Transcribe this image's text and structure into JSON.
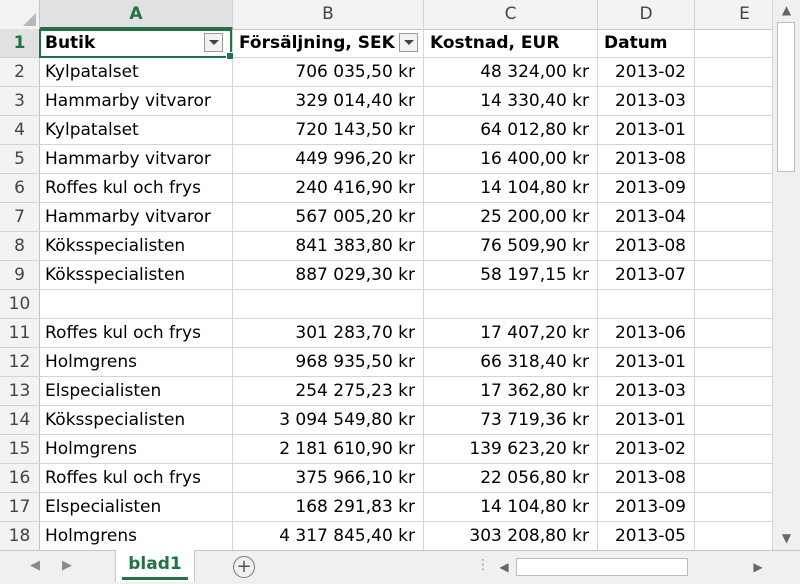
{
  "columns": [
    "A",
    "B",
    "C",
    "D",
    "E"
  ],
  "active_column": "A",
  "header_row": {
    "row_number": "1",
    "butik": "Butik",
    "forsaljning": "Försäljning, SEK",
    "kostnad": "Kostnad, EUR",
    "datum": "Datum"
  },
  "rows": [
    {
      "n": "2",
      "butik": "Kylpatalset",
      "forsaljning": "706 035,50 kr",
      "kostnad": "48 324,00 kr",
      "datum": "2013-02"
    },
    {
      "n": "3",
      "butik": "Hammarby vitvaror",
      "forsaljning": "329 014,40 kr",
      "kostnad": "14 330,40 kr",
      "datum": "2013-03"
    },
    {
      "n": "4",
      "butik": "Kylpatalset",
      "forsaljning": "720 143,50 kr",
      "kostnad": "64 012,80 kr",
      "datum": "2013-01"
    },
    {
      "n": "5",
      "butik": "Hammarby vitvaror",
      "forsaljning": "449 996,20 kr",
      "kostnad": "16 400,00 kr",
      "datum": "2013-08"
    },
    {
      "n": "6",
      "butik": "Roffes kul och frys",
      "forsaljning": "240 416,90 kr",
      "kostnad": "14 104,80 kr",
      "datum": "2013-09"
    },
    {
      "n": "7",
      "butik": "Hammarby vitvaror",
      "forsaljning": "567 005,20 kr",
      "kostnad": "25 200,00 kr",
      "datum": "2013-04"
    },
    {
      "n": "8",
      "butik": "Köksspecialisten",
      "forsaljning": "841 383,80 kr",
      "kostnad": "76 509,90 kr",
      "datum": "2013-08"
    },
    {
      "n": "9",
      "butik": "Köksspecialisten",
      "forsaljning": "887 029,30 kr",
      "kostnad": "58 197,15 kr",
      "datum": "2013-07"
    },
    {
      "n": "10",
      "butik": "",
      "forsaljning": "",
      "kostnad": "",
      "datum": ""
    },
    {
      "n": "11",
      "butik": "Roffes kul och frys",
      "forsaljning": "301 283,70 kr",
      "kostnad": "17 407,20 kr",
      "datum": "2013-06"
    },
    {
      "n": "12",
      "butik": "Holmgrens",
      "forsaljning": "968 935,50 kr",
      "kostnad": "66 318,40 kr",
      "datum": "2013-01"
    },
    {
      "n": "13",
      "butik": "Elspecialisten",
      "forsaljning": "254 275,23 kr",
      "kostnad": "17 362,80 kr",
      "datum": "2013-03"
    },
    {
      "n": "14",
      "butik": "Köksspecialisten",
      "forsaljning": "3 094 549,80 kr",
      "kostnad": "73 719,36 kr",
      "datum": "2013-01"
    },
    {
      "n": "15",
      "butik": "Holmgrens",
      "forsaljning": "2 181 610,90 kr",
      "kostnad": "139 623,20 kr",
      "datum": "2013-02"
    },
    {
      "n": "16",
      "butik": "Roffes kul och frys",
      "forsaljning": "375 966,10 kr",
      "kostnad": "22 056,80 kr",
      "datum": "2013-08"
    },
    {
      "n": "17",
      "butik": "Elspecialisten",
      "forsaljning": "168 291,83 kr",
      "kostnad": "14 104,80 kr",
      "datum": "2013-09"
    },
    {
      "n": "18",
      "butik": "Holmgrens",
      "forsaljning": "4 317 845,40 kr",
      "kostnad": "303 208,80 kr",
      "datum": "2013-05"
    }
  ],
  "sheet_tabs": [
    "blad1"
  ],
  "active_sheet": "blad1",
  "add_sheet_symbol": "+",
  "icons": {
    "add_sheet": "plus-circle-icon",
    "filter": "filter-dropdown-icon",
    "scroll_up": "triangle-up-icon",
    "scroll_down": "triangle-down-icon",
    "scroll_left": "triangle-left-icon",
    "scroll_right": "triangle-right-icon"
  },
  "colors": {
    "accent": "#217346",
    "header_bg": "#f3f3f3",
    "gridline": "#d4d4d4"
  }
}
